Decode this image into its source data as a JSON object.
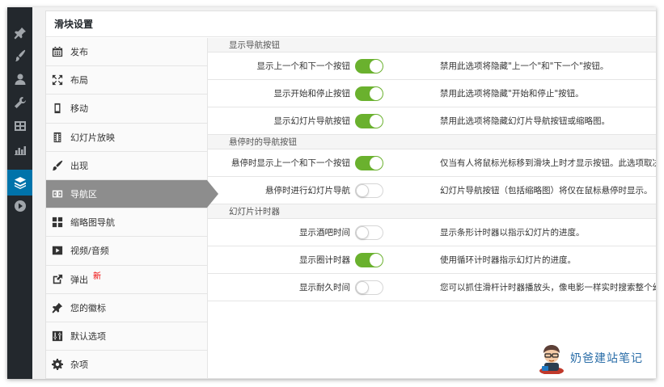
{
  "panel": {
    "title": "滑块设置"
  },
  "adminbar": {
    "items": [
      {
        "icon": "pin-icon"
      },
      {
        "icon": "brush-icon"
      },
      {
        "icon": "user-icon"
      },
      {
        "icon": "wrench-icon"
      },
      {
        "icon": "grid-icon"
      },
      {
        "icon": "chart-icon"
      },
      {
        "icon": "layers-icon",
        "active": true
      },
      {
        "icon": "play-icon"
      }
    ]
  },
  "nav": {
    "items": [
      {
        "label": "发布",
        "icon": "calendar-icon"
      },
      {
        "label": "布局",
        "icon": "expand-icon"
      },
      {
        "label": "移动",
        "icon": "mobile-icon"
      },
      {
        "label": "幻灯片放映",
        "icon": "film-icon"
      },
      {
        "label": "出现",
        "icon": "brush-icon"
      },
      {
        "label": "导航区",
        "icon": "navigation-icon",
        "active": true
      },
      {
        "label": "缩略图导航",
        "icon": "thumbnails-icon"
      },
      {
        "label": "视频/音频",
        "icon": "video-icon"
      },
      {
        "label": "弹出",
        "icon": "external-icon",
        "badge": "新"
      },
      {
        "label": "您的徽标",
        "icon": "pin-icon"
      },
      {
        "label": "默认选项",
        "icon": "sliders-icon"
      },
      {
        "label": "杂项",
        "icon": "gear-icon"
      }
    ]
  },
  "sections": [
    {
      "title": "显示导航按钮",
      "rows": [
        {
          "label": "显示上一个和下一个按钮",
          "on": true,
          "desc": "禁用此选项将隐藏\"上一个\"和\"下一个\"按钮。"
        },
        {
          "label": "显示开始和停止按钮",
          "on": true,
          "desc": "禁用此选项将隐藏\"开始和停止\"按钮。"
        },
        {
          "label": "显示幻灯片导航按钮",
          "on": true,
          "desc": "禁用此选项将隐藏幻灯片导航按钮或缩略图。"
        }
      ]
    },
    {
      "title": "悬停时的导航按钮",
      "rows": [
        {
          "label": "悬停时显示上一个和下一个按钮",
          "on": true,
          "desc": "仅当有人将鼠标光标移到滑块上时才显示按钮。此选项取决"
        },
        {
          "label": "悬停时进行幻灯片导航",
          "on": false,
          "desc": "幻灯片导航按钮（包括缩略图）将仅在鼠标悬停时显示。"
        }
      ]
    },
    {
      "title": "幻灯片计时器",
      "rows": [
        {
          "label": "显示酒吧时间",
          "on": false,
          "desc": "显示条形计时器以指示幻灯片的进度。"
        },
        {
          "label": "显示圈计时器",
          "on": true,
          "desc": "使用循环计时器指示幻灯片的进度。"
        },
        {
          "label": "显示耐久时间",
          "on": false,
          "desc": "您可以抓住滑杆计时器播放头，像电影一样实时搜索整个幻"
        }
      ]
    }
  ],
  "colors": {
    "toggle_on": "#6ab12e",
    "active_nav": "#8d8d8d",
    "admin_bar": "#23282d",
    "accent": "#0073aa"
  },
  "watermark": {
    "text": "奶爸建站笔记"
  }
}
